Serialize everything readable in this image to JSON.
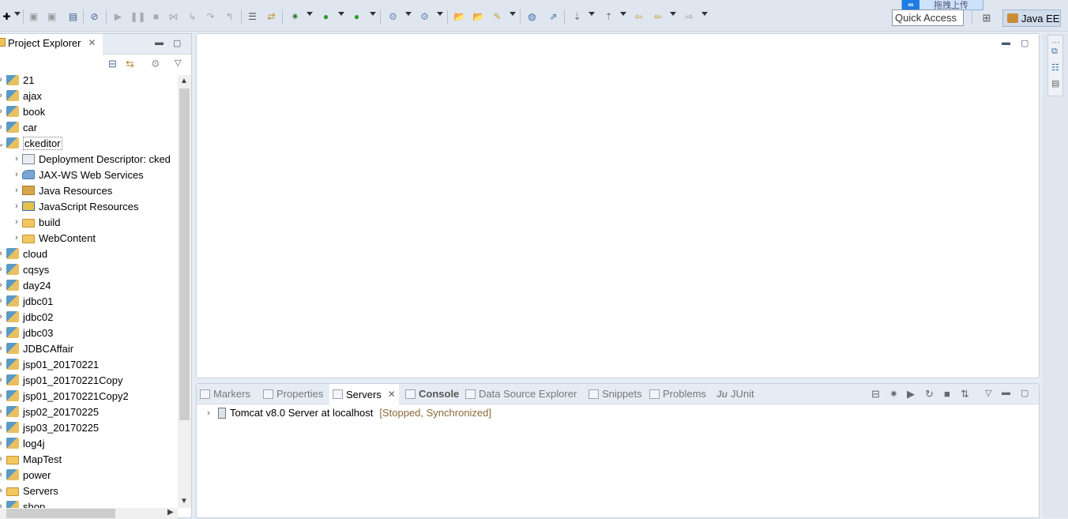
{
  "toolbar": {
    "quick_access_placeholder": "Quick Access",
    "perspective": "Java EE",
    "upload_badge": "拖拽上传",
    "upload_icon": "∞"
  },
  "explorer": {
    "title": "Project Explorer",
    "close": "✕",
    "items": [
      {
        "label": "21",
        "icon": "project-icon",
        "level": 0,
        "expanded": false
      },
      {
        "label": "ajax",
        "icon": "project-icon",
        "level": 0,
        "expanded": false
      },
      {
        "label": "book",
        "icon": "project-icon",
        "level": 0,
        "expanded": false
      },
      {
        "label": "car",
        "icon": "project-icon",
        "level": 0,
        "expanded": false
      },
      {
        "label": "ckeditor",
        "icon": "project-icon",
        "level": 0,
        "expanded": true,
        "selected": true
      },
      {
        "label": "Deployment Descriptor: cked",
        "icon": "deployment-descriptor-icon",
        "level": 1,
        "expanded": false
      },
      {
        "label": "JAX-WS Web Services",
        "icon": "web-services-icon",
        "level": 1,
        "expanded": false
      },
      {
        "label": "Java Resources",
        "icon": "java-resources-icon",
        "level": 1,
        "expanded": false
      },
      {
        "label": "JavaScript Resources",
        "icon": "javascript-resources-icon",
        "level": 1,
        "expanded": false
      },
      {
        "label": "build",
        "icon": "folder-icon",
        "level": 1,
        "expanded": false
      },
      {
        "label": "WebContent",
        "icon": "folder-icon",
        "level": 1,
        "expanded": false
      },
      {
        "label": "cloud",
        "icon": "project-icon",
        "level": 0,
        "expanded": false
      },
      {
        "label": "cqsys",
        "icon": "project-icon",
        "level": 0,
        "expanded": false
      },
      {
        "label": "day24",
        "icon": "project-icon",
        "level": 0,
        "expanded": false
      },
      {
        "label": "jdbc01",
        "icon": "project-icon",
        "level": 0,
        "expanded": false
      },
      {
        "label": "jdbc02",
        "icon": "project-icon",
        "level": 0,
        "expanded": false
      },
      {
        "label": "jdbc03",
        "icon": "project-icon",
        "level": 0,
        "expanded": false
      },
      {
        "label": "JDBCAffair",
        "icon": "project-icon",
        "level": 0,
        "expanded": false
      },
      {
        "label": "jsp01_20170221",
        "icon": "project-icon",
        "level": 0,
        "expanded": false
      },
      {
        "label": "jsp01_20170221Copy",
        "icon": "project-icon",
        "level": 0,
        "expanded": false
      },
      {
        "label": "jsp01_20170221Copy2",
        "icon": "project-icon",
        "level": 0,
        "expanded": false
      },
      {
        "label": "jsp02_20170225",
        "icon": "project-icon",
        "level": 0,
        "expanded": false
      },
      {
        "label": "jsp03_20170225",
        "icon": "project-icon",
        "level": 0,
        "expanded": false
      },
      {
        "label": "log4j",
        "icon": "project-icon",
        "level": 0,
        "expanded": false
      },
      {
        "label": "MapTest",
        "icon": "folder-icon",
        "level": 0,
        "expanded": false
      },
      {
        "label": "power",
        "icon": "project-icon",
        "level": 0,
        "expanded": false
      },
      {
        "label": "Servers",
        "icon": "folder-icon",
        "level": 0,
        "expanded": false
      },
      {
        "label": "shop",
        "icon": "project-icon",
        "level": 0,
        "expanded": false
      }
    ]
  },
  "bottom": {
    "tabs": [
      {
        "label": "Markers",
        "icon": "markers-icon",
        "active": false
      },
      {
        "label": "Properties",
        "icon": "properties-icon",
        "active": false
      },
      {
        "label": "Servers",
        "icon": "servers-icon",
        "active": true
      },
      {
        "label": "Console",
        "icon": "console-icon",
        "active": false,
        "bold": true
      },
      {
        "label": "Data Source Explorer",
        "icon": "data-source-icon",
        "active": false
      },
      {
        "label": "Snippets",
        "icon": "snippets-icon",
        "active": false
      },
      {
        "label": "Problems",
        "icon": "problems-icon",
        "active": false
      },
      {
        "label": "JUnit",
        "icon": "junit-icon",
        "active": false
      }
    ],
    "junit_prefix": "Ju",
    "tab_close": "✕",
    "server": {
      "name": "Tomcat v8.0 Server at localhost",
      "state": "[Stopped, Synchronized]"
    }
  },
  "colors": {
    "accent": "#3f6aa3",
    "server_state": "#8a6a3a",
    "selection_outline": "#777777"
  }
}
